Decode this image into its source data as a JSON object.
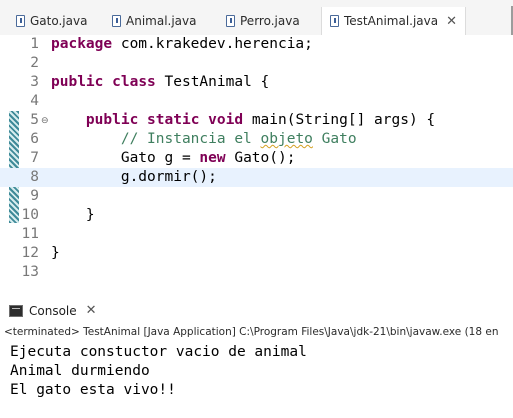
{
  "tabs": [
    {
      "label": "Gato.java",
      "active": false,
      "closable": false
    },
    {
      "label": "Animal.java",
      "active": false,
      "closable": false
    },
    {
      "label": "Perro.java",
      "active": false,
      "closable": false
    },
    {
      "label": "TestAnimal.java",
      "active": true,
      "closable": true
    }
  ],
  "editor": {
    "current_line": 8,
    "lines": [
      {
        "n": "1",
        "tokens": [
          {
            "t": "package",
            "c": "kw"
          },
          {
            "t": " com.krakedev.herencia;"
          }
        ]
      },
      {
        "n": "2",
        "tokens": []
      },
      {
        "n": "3",
        "tokens": [
          {
            "t": "public",
            "c": "kw"
          },
          {
            "t": " "
          },
          {
            "t": "class",
            "c": "kw"
          },
          {
            "t": " TestAnimal {"
          }
        ]
      },
      {
        "n": "4",
        "tokens": []
      },
      {
        "n": "5",
        "fold": true,
        "tokens": [
          {
            "t": "    "
          },
          {
            "t": "public",
            "c": "kw"
          },
          {
            "t": " "
          },
          {
            "t": "static",
            "c": "kw"
          },
          {
            "t": " "
          },
          {
            "t": "void",
            "c": "kw"
          },
          {
            "t": " main(String[] args) {"
          }
        ]
      },
      {
        "n": "6",
        "tokens": [
          {
            "t": "        "
          },
          {
            "t": "// Instancia el ",
            "c": "cm"
          },
          {
            "t": "objeto",
            "c": "cm sq"
          },
          {
            "t": " Gato",
            "c": "cm"
          }
        ]
      },
      {
        "n": "7",
        "tokens": [
          {
            "t": "        Gato g = "
          },
          {
            "t": "new",
            "c": "kw"
          },
          {
            "t": " Gato();"
          }
        ]
      },
      {
        "n": "8",
        "tokens": [
          {
            "t": "        g.dormir();"
          }
        ]
      },
      {
        "n": "9",
        "tokens": []
      },
      {
        "n": "10",
        "tokens": [
          {
            "t": "    }"
          }
        ]
      },
      {
        "n": "11",
        "tokens": []
      },
      {
        "n": "12",
        "tokens": [
          {
            "t": "}"
          }
        ]
      },
      {
        "n": "13",
        "tokens": []
      }
    ]
  },
  "console": {
    "tab_label": "Console",
    "status": "<terminated> TestAnimal [Java Application] C:\\Program Files\\Java\\jdk-21\\bin\\javaw.exe  (18 en",
    "output": [
      "Ejecuta constuctor vacio de animal",
      "Animal durmiendo",
      "El gato esta vivo!!"
    ]
  },
  "icons": {
    "tab_file": "java-file-icon",
    "tab_close": "close-icon",
    "fold": "fold-collapse-icon",
    "scroll_left": "scroll-left-icon",
    "console": "console-icon"
  },
  "colors": {
    "keyword": "#7f0055",
    "comment": "#3f7f5f",
    "current_line": "#e8f2fe",
    "line_number": "#787878"
  }
}
